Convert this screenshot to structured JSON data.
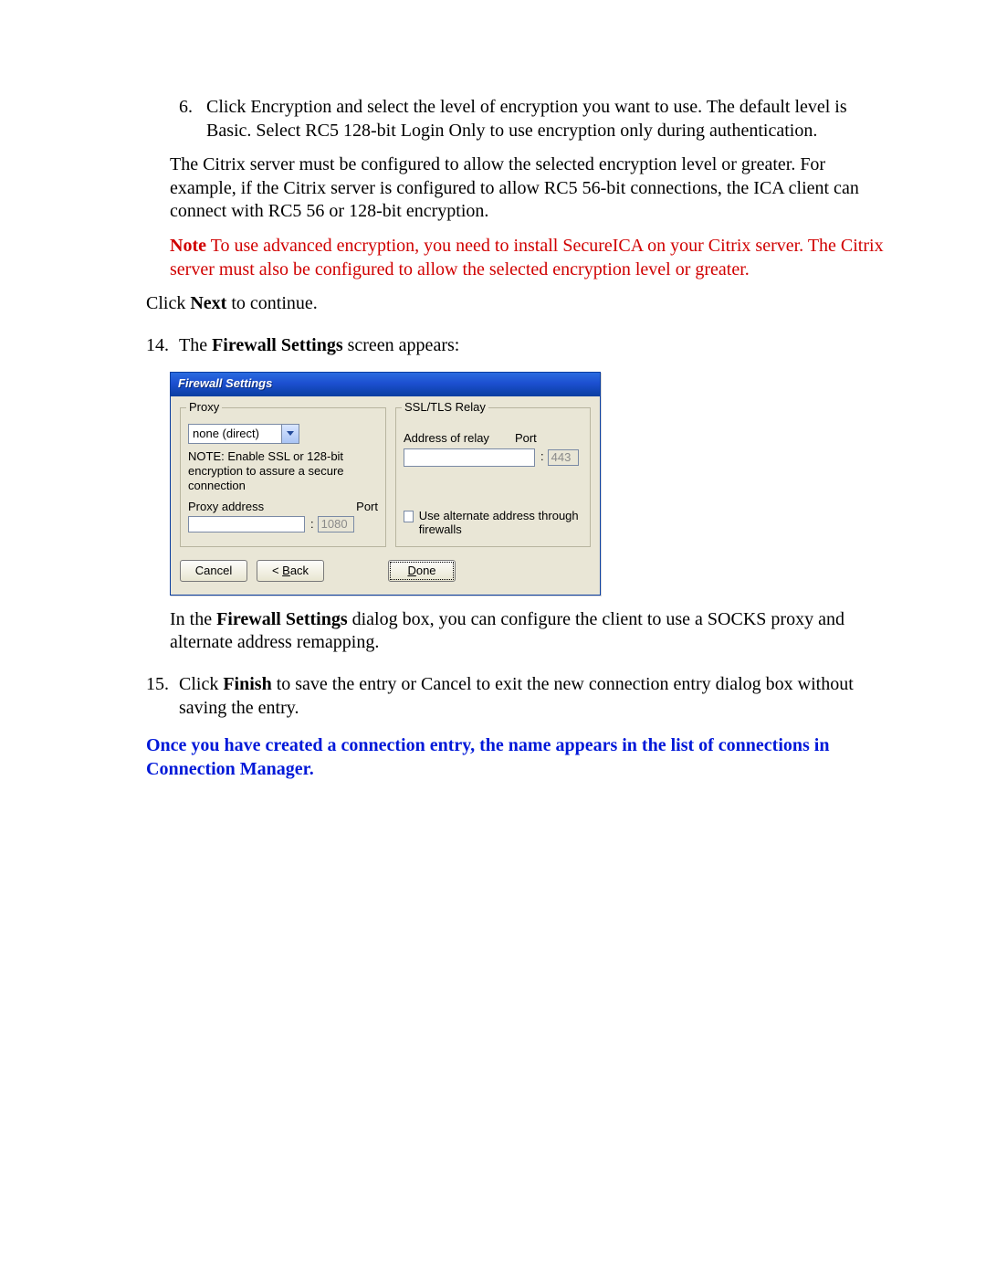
{
  "step6": {
    "num": "6.",
    "text": "Click Encryption and select the level of encryption you want to use. The default level is Basic. Select RC5 128-bit Login Only to use encryption only during authentication."
  },
  "para_server": "The Citrix server must be configured to allow the selected encryption level or greater. For example, if the Citrix server is configured to allow RC5 56-bit connections, the ICA client can connect with RC5 56 or 128-bit encryption.",
  "note": {
    "label": "Note",
    "text": " To use advanced encryption, you need to install SecureICA on your Citrix server. The Citrix server must also be configured to allow the selected encryption level or greater."
  },
  "click_next_prefix": "Click ",
  "click_next_bold": "Next",
  "click_next_suffix": " to continue.",
  "step14": {
    "num": "14.",
    "prefix": "The ",
    "bold": "Firewall Settings",
    "suffix": " screen appears:"
  },
  "dialog": {
    "title": "Firewall Settings",
    "proxy": {
      "legend": "Proxy",
      "combo_value": "none (direct)",
      "note": "NOTE: Enable SSL or 128-bit encryption to assure a secure connection",
      "addr_label": "Proxy address",
      "port_label": "Port",
      "port_value": "1080",
      "colon": ":"
    },
    "relay": {
      "legend": "SSL/TLS Relay",
      "addr_label": "Address of relay",
      "port_label": "Port",
      "port_value": "443",
      "colon": ":"
    },
    "checkbox_label": "Use alternate address through firewalls",
    "buttons": {
      "cancel": "Cancel",
      "back_prefix": "< ",
      "back_u": "B",
      "back_rest": "ack",
      "done_u": "D",
      "done_rest": "one"
    }
  },
  "after_dialog": {
    "prefix": "In the ",
    "bold": "Firewall Settings",
    "suffix": " dialog box, you can configure the client to use a SOCKS proxy and alternate address remapping."
  },
  "step15": {
    "num": "15.",
    "prefix": "Click ",
    "bold": "Finish",
    "suffix": " to save the entry or Cancel to exit the new connection entry dialog box without saving the entry."
  },
  "blue_summary": "Once you have created a connection entry, the name appears in the list of connections in Connection Manager."
}
